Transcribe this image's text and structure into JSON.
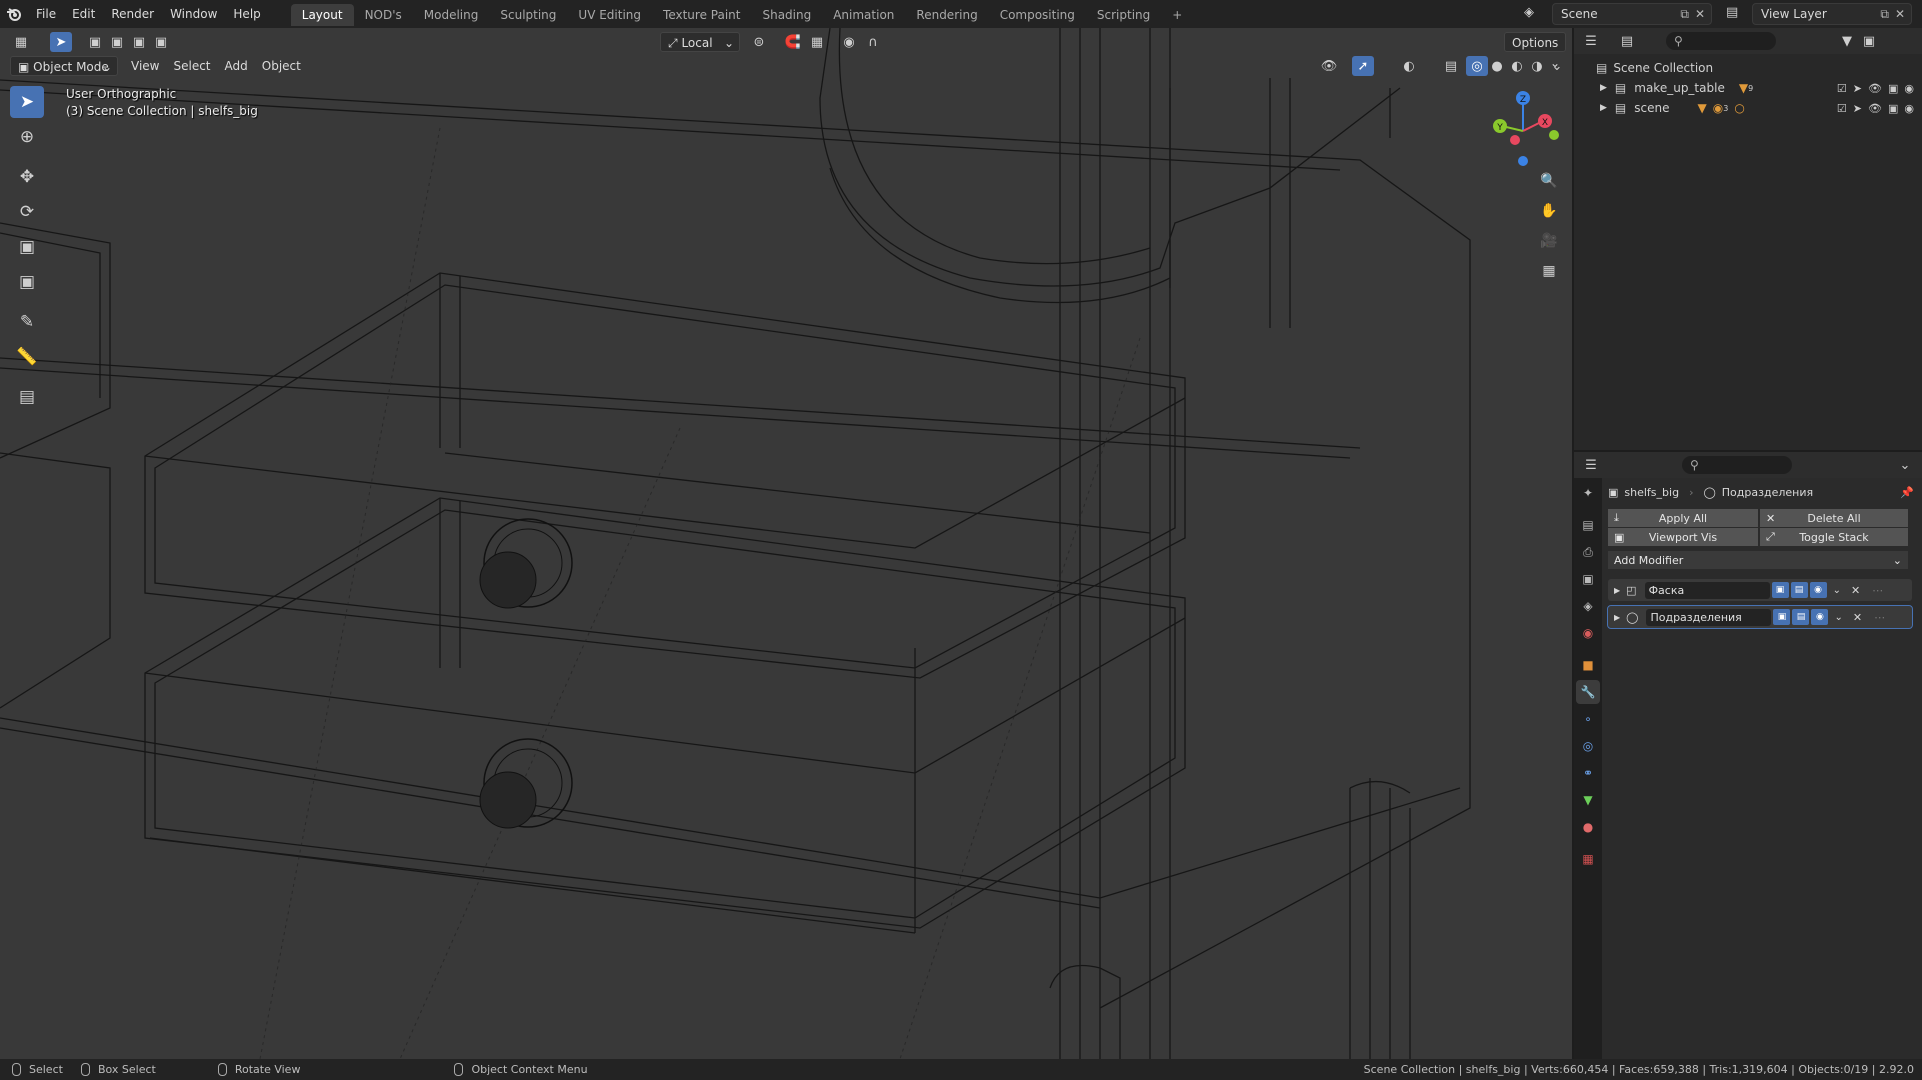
{
  "topbar": {
    "menus": [
      "File",
      "Edit",
      "Render",
      "Window",
      "Help"
    ],
    "workspace_tabs": [
      "Layout",
      "NOD's",
      "Modeling",
      "Sculpting",
      "UV Editing",
      "Texture Paint",
      "Shading",
      "Animation",
      "Rendering",
      "Compositing",
      "Scripting"
    ],
    "active_tab": "Layout",
    "add_tab": "+",
    "scene_name": "Scene",
    "view_layer": "View Layer"
  },
  "viewport": {
    "mode": "Object Mode",
    "menus": [
      "View",
      "Select",
      "Add",
      "Object"
    ],
    "transform_orientation": "Local",
    "options_label": "Options",
    "view_name": "User Orthographic",
    "context_line": "(3) Scene Collection | shelfs_big",
    "gizmo_axes": {
      "x": "X",
      "y": "Y",
      "z": "Z"
    }
  },
  "colors": {
    "accent": "#4772b3",
    "axis_x": "#e8485f",
    "axis_y": "#8ac92c",
    "axis_z": "#3b83e6",
    "wire": "#111111"
  },
  "outliner": {
    "root": "Scene Collection",
    "items": [
      {
        "name": "make_up_table",
        "badge": "9"
      },
      {
        "name": "scene",
        "badge": "3"
      }
    ]
  },
  "properties": {
    "object_name": "shelfs_big",
    "modifier_context": "Подразделения",
    "apply_all": "Apply All",
    "delete_all": "Delete All",
    "viewport_vis": "Viewport Vis",
    "toggle_stack": "Toggle Stack",
    "add_modifier": "Add Modifier",
    "modifiers": [
      {
        "name": "Фаска"
      },
      {
        "name": "Подразделения"
      }
    ]
  },
  "statusbar": {
    "select": "Select",
    "box_select": "Box Select",
    "rotate_view": "Rotate View",
    "context_menu": "Object Context Menu",
    "stats": "Scene Collection | shelfs_big | Verts:660,454 | Faces:659,388 | Tris:1,319,604 | Objects:0/19 | 2.92.0"
  }
}
